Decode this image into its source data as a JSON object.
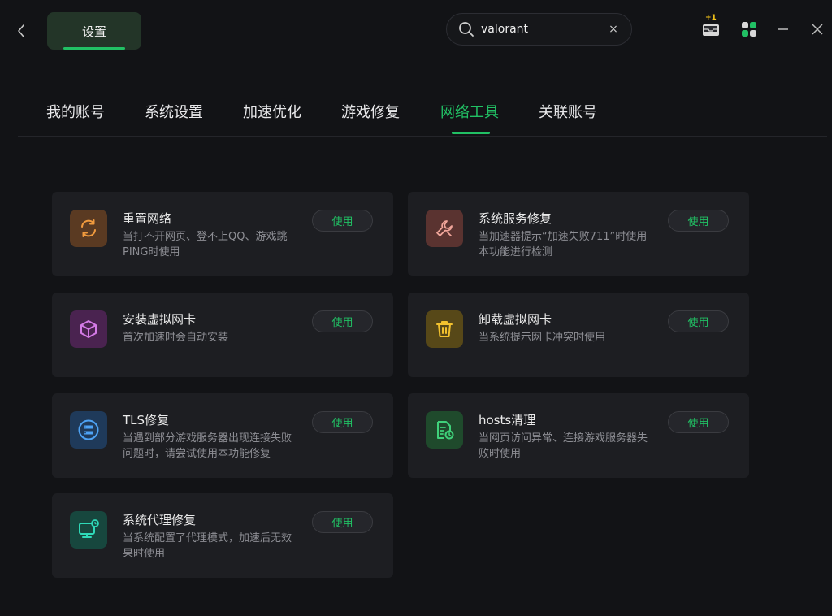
{
  "header": {
    "settings_label": "设置",
    "search": {
      "value": "valorant",
      "placeholder": ""
    },
    "clear_symbol": "×",
    "inbox_badge": "+1"
  },
  "tabs": [
    {
      "label": "我的账号",
      "active": false
    },
    {
      "label": "系统设置",
      "active": false
    },
    {
      "label": "加速优化",
      "active": false
    },
    {
      "label": "游戏修复",
      "active": false
    },
    {
      "label": "网络工具",
      "active": true
    },
    {
      "label": "关联账号",
      "active": false
    }
  ],
  "tools": [
    {
      "title": "重置网络",
      "desc": "当打不开网页、登不上QQ、游戏跳PING时使用",
      "button": "使用",
      "icon": "refresh-icon"
    },
    {
      "title": "系统服务修复",
      "desc": "当加速器提示“加速失败711”时使用本功能进行检测",
      "button": "使用",
      "icon": "wrench-icon"
    },
    {
      "title": "安装虚拟网卡",
      "desc": "首次加速时会自动安装",
      "button": "使用",
      "icon": "cube-icon"
    },
    {
      "title": "卸载虚拟网卡",
      "desc": "当系统提示网卡冲突时使用",
      "button": "使用",
      "icon": "trash-icon"
    },
    {
      "title": "TLS修复",
      "desc": "当遇到部分游戏服务器出现连接失败问题时，请尝试使用本功能修复",
      "button": "使用",
      "icon": "server-icon"
    },
    {
      "title": "hosts清理",
      "desc": "当网页访问异常、连接游戏服务器失败时使用",
      "button": "使用",
      "icon": "document-clean-icon"
    },
    {
      "title": "系统代理修复",
      "desc": "当系统配置了代理模式，加速后无效果时使用",
      "button": "使用",
      "icon": "monitor-icon"
    }
  ],
  "colors": {
    "accent": "#21c064",
    "background": "#121316",
    "card": "#1d1e22"
  }
}
